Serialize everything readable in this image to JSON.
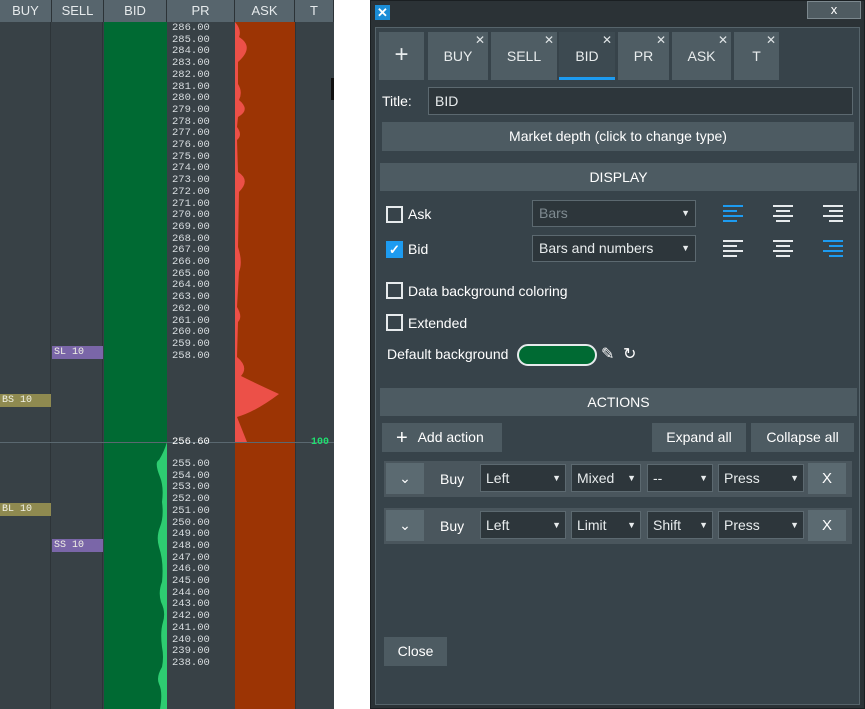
{
  "dom": {
    "headers": [
      "BUY",
      "SELL",
      "BID",
      "PR",
      "ASK",
      "T"
    ],
    "prices_upper": [
      "286.00",
      "285.00",
      "284.00",
      "283.00",
      "282.00",
      "281.00",
      "280.00",
      "279.00",
      "278.00",
      "277.00",
      "276.00",
      "275.00",
      "274.00",
      "273.00",
      "272.00",
      "271.00",
      "270.00",
      "269.00",
      "268.00",
      "267.00",
      "266.00",
      "265.00",
      "264.00",
      "263.00",
      "262.00",
      "261.00",
      "260.00",
      "259.00",
      "258.00"
    ],
    "current_price": "256.60",
    "prices_lower": [
      "255.00",
      "254.00",
      "253.00",
      "252.00",
      "251.00",
      "250.00",
      "249.00",
      "248.00",
      "247.00",
      "246.00",
      "245.00",
      "244.00",
      "243.00",
      "242.00",
      "241.00",
      "240.00",
      "239.00",
      "238.00"
    ],
    "orders": {
      "sl": "SL 10",
      "bs": "BS 10",
      "bl": "BL 10",
      "ss": "SS 10"
    },
    "t_value": "100",
    "colors": {
      "bid": "#006a33",
      "ask": "#9c3404",
      "ask_profile": "#ec5048",
      "bid_profile": "#2ecc71"
    }
  },
  "dialog": {
    "close_window": "x",
    "add_tab": "+",
    "tabs": [
      {
        "label": "BUY",
        "close": "✕"
      },
      {
        "label": "SELL",
        "close": "✕"
      },
      {
        "label": "BID",
        "close": "✕"
      },
      {
        "label": "PR",
        "close": "✕"
      },
      {
        "label": "ASK",
        "close": "✕"
      },
      {
        "label": "T",
        "close": "✕"
      }
    ],
    "active_tab": "BID",
    "title_label": "Title:",
    "title_value": "BID",
    "type_button": "Market depth (click to change type)",
    "display_section": "DISPLAY",
    "ask_label": "Ask",
    "ask_checked": false,
    "ask_mode": "Bars",
    "bid_label": "Bid",
    "bid_checked": true,
    "bid_mode": "Bars and numbers",
    "check_mark": "✓",
    "dropdown_arrow": "▼",
    "data_bg_label": "Data background coloring",
    "extended_label": "Extended",
    "default_bg_label": "Default background",
    "default_bg_color": "#006a33",
    "eyedropper_icon": "✎",
    "reset_icon": "↻",
    "actions_section": "ACTIONS",
    "add_action_icon": "+",
    "add_action": "Add action",
    "expand_all": "Expand all",
    "collapse_all": "Collapse all",
    "chevron_icon": "⌄",
    "actions": [
      {
        "side": "Buy",
        "button": "Left",
        "type": "Mixed",
        "modifier": "--",
        "event": "Press",
        "remove": "X"
      },
      {
        "side": "Buy",
        "button": "Left",
        "type": "Limit",
        "modifier": "Shift",
        "event": "Press",
        "remove": "X"
      }
    ],
    "close_button": "Close"
  }
}
